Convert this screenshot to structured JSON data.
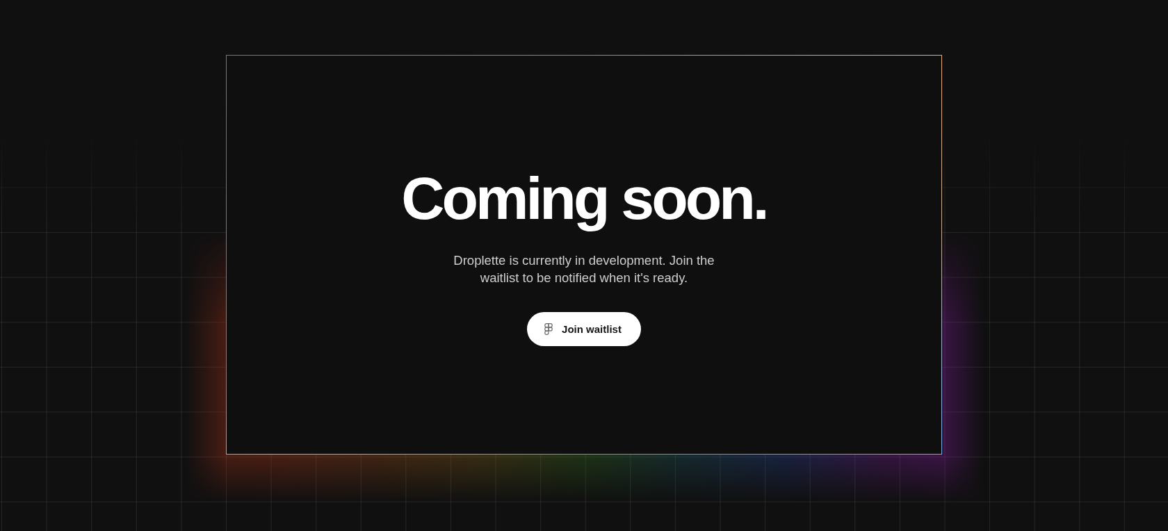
{
  "page": {
    "heading": "Coming soon.",
    "description": "Droplette is currently in development. Join the waitlist to be notified when it's ready.",
    "button": {
      "label": "Join waitlist"
    }
  }
}
